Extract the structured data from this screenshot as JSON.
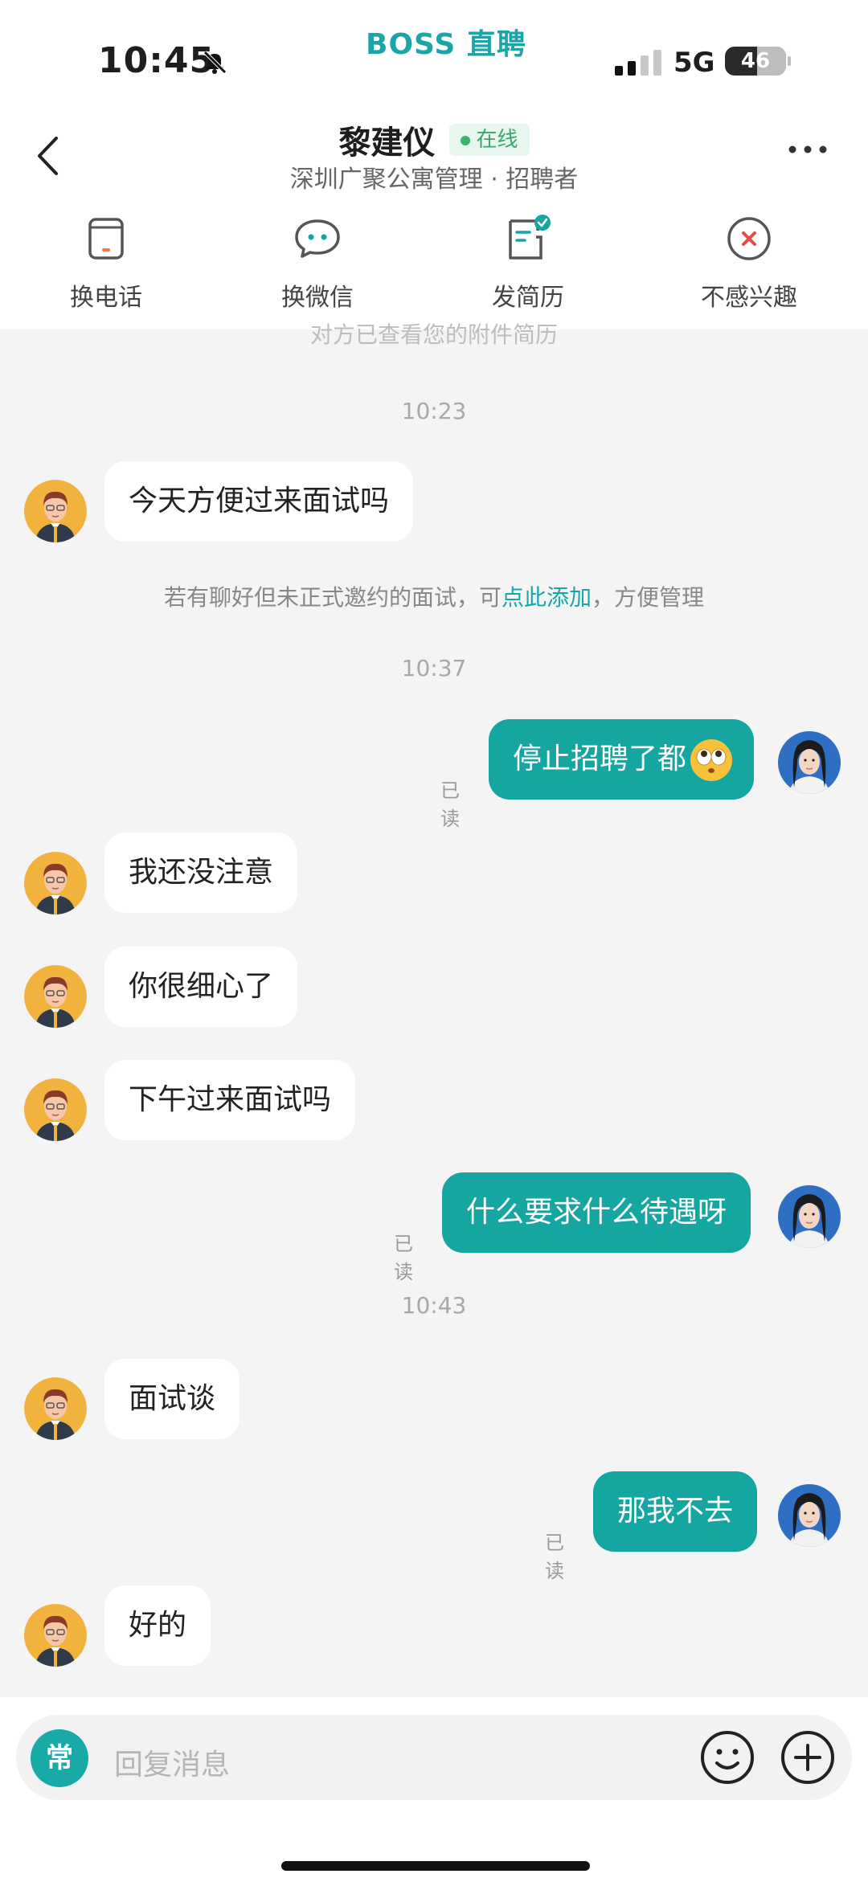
{
  "status": {
    "time": "10:45",
    "brand": "BOSS 直聘",
    "network": "5G",
    "battery": "46"
  },
  "header": {
    "name": "黎建仪",
    "online": "在线",
    "subtitle": "深圳广聚公寓管理 · 招聘者"
  },
  "actions": [
    {
      "label": "换电话",
      "icon": "phone-card-icon"
    },
    {
      "label": "换微信",
      "icon": "wechat-bubble-icon"
    },
    {
      "label": "发简历",
      "icon": "resume-icon"
    },
    {
      "label": "不感兴趣",
      "icon": "not-interested-icon"
    }
  ],
  "chat": {
    "clipped_system": "对方已查看您的附件简历",
    "t1": "10:23",
    "m1": "今天方便过来面试吗",
    "hint_pre": "若有聊好但未正式邀约的面试，可",
    "hint_link": "点此添加",
    "hint_post": "，方便管理",
    "t2": "10:37",
    "m2": "停止招聘了都",
    "read": "已读",
    "m3": "我还没注意",
    "m4": "你很细心了",
    "m5": "下午过来面试吗",
    "m6": "什么要求什么待遇呀",
    "t3": "10:43",
    "m7": "面试谈",
    "m8": "那我不去",
    "m9": "好的"
  },
  "input": {
    "common_label": "常",
    "placeholder": "回复消息"
  },
  "colors": {
    "accent": "#16a6a2",
    "link": "#1aa6a8",
    "online_green": "#39b36b"
  }
}
